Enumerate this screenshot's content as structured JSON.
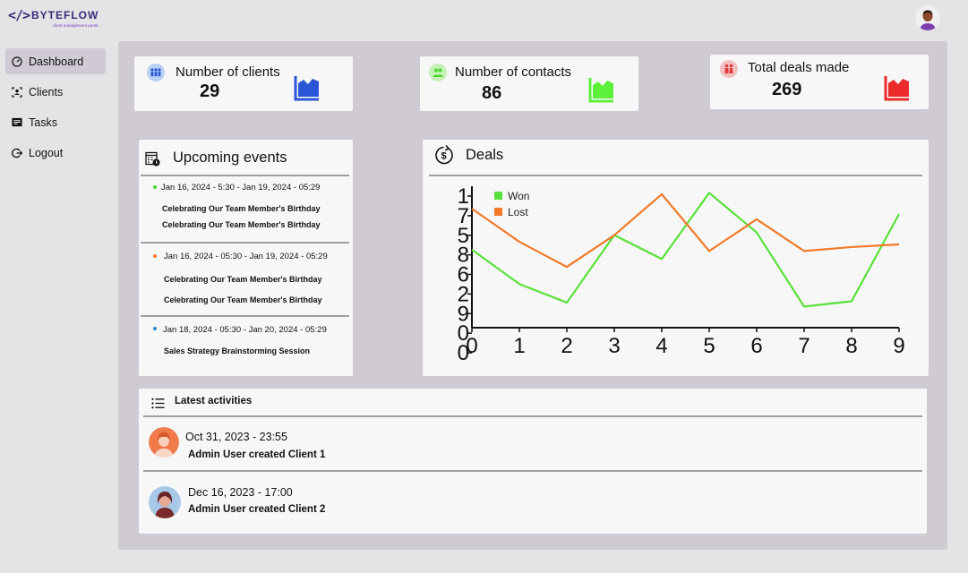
{
  "brand": {
    "mark": "</>",
    "name": "BYTEFLOW",
    "tagline": "client management portal"
  },
  "nav": [
    {
      "label": "Dashboard",
      "icon": "dashboard-icon",
      "active": true
    },
    {
      "label": "Clients",
      "icon": "clients-icon"
    },
    {
      "label": "Tasks",
      "icon": "tasks-icon"
    },
    {
      "label": "Logout",
      "icon": "logout-icon"
    }
  ],
  "stats": {
    "clients": {
      "label": "Number of clients",
      "value": "29",
      "color": "#2a55d6"
    },
    "contacts": {
      "label": "Number of contacts",
      "value": "86",
      "color": "#5df03a"
    },
    "deals": {
      "label": "Total deals made",
      "value": "269",
      "color": "#ec2a2a"
    }
  },
  "events": {
    "title": "Upcoming events",
    "items": [
      {
        "date": "Jan 16, 2024 - 5:30 - Jan 19, 2024 - 05:29",
        "color": "#4ad62a",
        "lines": [
          "Celebrating Our Team Member's Birthday",
          "Celebrating Our Team Member's Birthday"
        ]
      },
      {
        "date": "Jan 16, 2024 - 05:30 - Jan 19, 2024 - 05:29",
        "color": "#f07a2a",
        "lines": [
          "Celebrating Our Team Member's Birthday",
          "Celebrating Our Team Member's Birthday"
        ]
      },
      {
        "date": "Jan 18, 2024 - 05:30 - Jan 20, 2024 - 05:29",
        "color": "#2a8ad6",
        "lines": [
          "Sales Strategy Brainstorming Session"
        ]
      }
    ]
  },
  "deals_panel": {
    "title": "Deals"
  },
  "chart_data": {
    "type": "line",
    "x": [
      0,
      1,
      2,
      3,
      4,
      5,
      6,
      7,
      8,
      9
    ],
    "x_tick_labels": [
      "0",
      "1",
      "2",
      "3",
      "4",
      "5",
      "6",
      "7",
      "8",
      "9"
    ],
    "y_tick_labels": [
      "1",
      "7",
      "5",
      "8",
      "6",
      "2",
      "9",
      "0",
      "0"
    ],
    "series": [
      {
        "name": "Won",
        "color": "#5ae03a",
        "values": [
          0.59,
          0.33,
          0.19,
          0.7,
          0.52,
          1.02,
          0.72,
          0.16,
          0.2,
          0.86
        ]
      },
      {
        "name": "Lost",
        "color": "#f27a28",
        "values": [
          0.9,
          0.65,
          0.46,
          0.7,
          1.01,
          0.58,
          0.82,
          0.58,
          0.61,
          0.63
        ]
      }
    ],
    "legend_position": "top-left",
    "grid": false
  },
  "activities": {
    "title": "Latest activities",
    "items": [
      {
        "date": "Oct 31, 2023 - 23:55",
        "text": "Admin User created Client 1",
        "avatar": "avatar-orange-icon"
      },
      {
        "date": "Dec 16, 2023 - 17:00",
        "text": "Admin User created Client 2",
        "avatar": "avatar-maroon-icon"
      }
    ]
  }
}
